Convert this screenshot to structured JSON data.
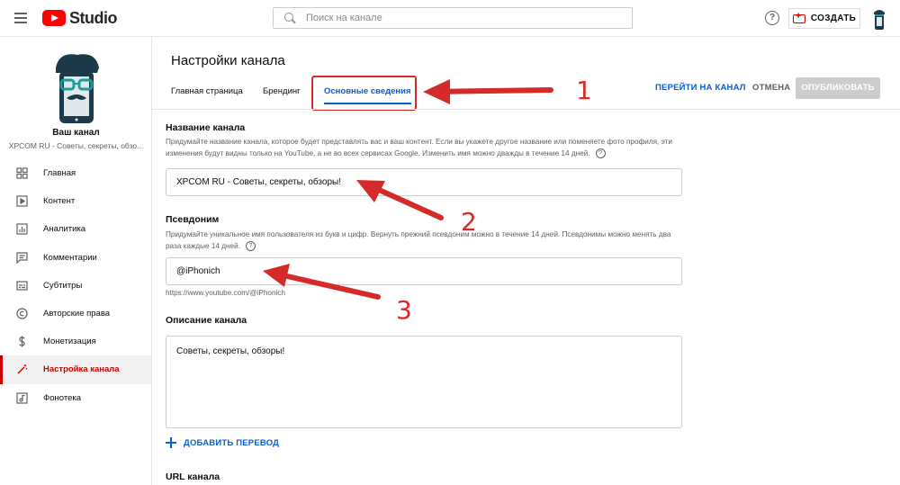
{
  "app": {
    "logo_text": "Studio",
    "search_placeholder": "Поиск на канале",
    "help_label": "?",
    "create_label": "СОЗДАТЬ"
  },
  "sidebar": {
    "channel_title": "Ваш канал",
    "channel_name": "XPCOM RU - Советы, секреты, обзо...",
    "items": [
      {
        "label": "Главная",
        "icon": "dashboard-icon"
      },
      {
        "label": "Контент",
        "icon": "content-icon"
      },
      {
        "label": "Аналитика",
        "icon": "analytics-icon"
      },
      {
        "label": "Комментарии",
        "icon": "comments-icon"
      },
      {
        "label": "Субтитры",
        "icon": "subtitles-icon"
      },
      {
        "label": "Авторские права",
        "icon": "copyright-icon"
      },
      {
        "label": "Монетизация",
        "icon": "monetization-icon"
      },
      {
        "label": "Настройка канала",
        "icon": "customization-icon",
        "active": true
      },
      {
        "label": "Фонотека",
        "icon": "audio-library-icon"
      }
    ]
  },
  "main": {
    "title": "Настройки канала",
    "tabs": [
      {
        "label": "Главная страница"
      },
      {
        "label": "Брендинг"
      },
      {
        "label": "Основные сведения",
        "active": true
      }
    ],
    "actions": {
      "go_to_channel": "ПЕРЕЙТИ НА КАНАЛ",
      "cancel": "ОТМЕНА",
      "publish": "ОПУБЛИКОВАТЬ"
    },
    "name_section": {
      "label": "Название канала",
      "description": "Придумайте название канала, которое будет представлять вас и ваш контент. Если вы укажете другое название или поменяете фото профиля, эти изменения будут видны только на YouTube, а не во всех сервисах Google. Изменить имя можно дважды в течение 14 дней.",
      "value": "XPCOM RU - Советы, секреты, обзоры!"
    },
    "handle_section": {
      "label": "Псевдоним",
      "description": "Придумайте уникальное имя пользователя из букв и цифр. Вернуть прежний псевдоним можно в течение 14 дней. Псевдонимы можно менять два раза каждые 14 дней.",
      "value": "@iPhonich",
      "url_hint": "https://www.youtube.com/@iPhonich"
    },
    "description_section": {
      "label": "Описание канала",
      "value": "Советы, секреты, обзоры!",
      "add_translation": "ДОБАВИТЬ ПЕРЕВОД"
    },
    "url_section": {
      "label": "URL канала"
    }
  },
  "annotations": {
    "numbers": [
      "1",
      "2",
      "3"
    ],
    "color": "#d42a2a"
  },
  "colors": {
    "accent_blue": "#065fd4",
    "accent_red": "#cc0000",
    "youtube_red": "#ff0000",
    "publish_disabled": "#cccccc"
  }
}
